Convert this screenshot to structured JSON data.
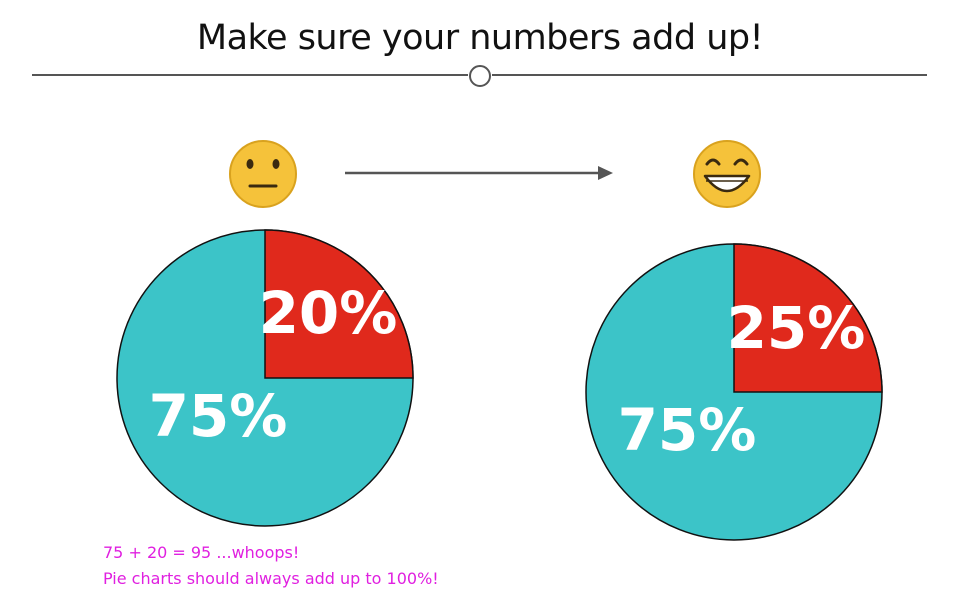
{
  "page": {
    "title": "Make sure your numbers add up!",
    "note_line1": "75 + 20 = 95 ...whoops!",
    "note_line2": "Pie charts should always add up to 100%!"
  },
  "icons": {
    "before": "neutral-face-icon",
    "after": "grinning-face-icon",
    "connector": "right-arrow-icon"
  },
  "colors": {
    "teal": "#3cc4c8",
    "red": "#e0291c",
    "note": "#e020e0",
    "line": "#555555",
    "face": "#f5c23a"
  },
  "chart_data": [
    {
      "type": "pie",
      "values": [
        20,
        75
      ],
      "labels": [
        "20%",
        "75%"
      ],
      "colors": [
        "#e0291c",
        "#3cc4c8"
      ]
    },
    {
      "type": "pie",
      "values": [
        25,
        75
      ],
      "labels": [
        "25%",
        "75%"
      ],
      "colors": [
        "#e0291c",
        "#3cc4c8"
      ]
    }
  ]
}
